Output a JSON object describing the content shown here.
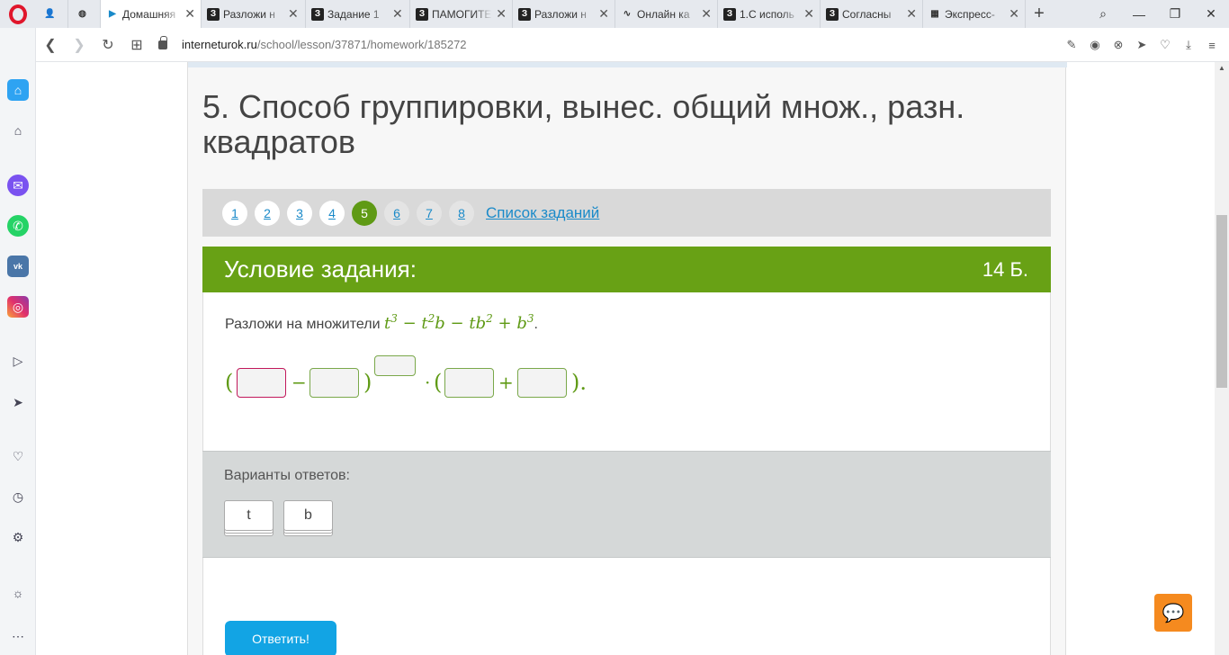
{
  "browser": {
    "tabs": [
      {
        "label": "",
        "icon": "avatar-icon"
      },
      {
        "label": "",
        "icon": "globe-icon"
      },
      {
        "label": "Домашняя",
        "icon": "play-icon"
      },
      {
        "label": "Разложи н",
        "icon": "znanija-icon"
      },
      {
        "label": "Задание 1",
        "icon": "znanija-icon"
      },
      {
        "label": "ПАМОГИТЕ",
        "icon": "znanija-icon"
      },
      {
        "label": "Разложи н",
        "icon": "znanija-icon"
      },
      {
        "label": "Онлайн ка",
        "icon": "calc-icon"
      },
      {
        "label": "1.С исполь",
        "icon": "znanija-icon"
      },
      {
        "label": "Согласны",
        "icon": "znanija-icon"
      },
      {
        "label": "Экспресс-",
        "icon": "grid-icon"
      }
    ],
    "url_host": "interneturok.ru",
    "url_path": "/school/lesson/37871/homework/185272"
  },
  "lesson": {
    "title": "5. Способ группировки, вынес. общий множ., разн. квадратов"
  },
  "pager": {
    "pages": [
      "1",
      "2",
      "3",
      "4",
      "5",
      "6",
      "7",
      "8"
    ],
    "current": "5",
    "list_link": "Список заданий"
  },
  "task": {
    "header_title": "Условие задания:",
    "points": "14 Б.",
    "statement_prefix": "Разложи на множители",
    "formula": {
      "t": "t",
      "b": "b",
      "exp3": "3",
      "exp2": "2",
      "minus": "−",
      "plus": "+"
    },
    "answer_ops": {
      "open": "(",
      "close": ")",
      "minus": "−",
      "plus": "+",
      "dot": "·",
      "end": ")."
    }
  },
  "options": {
    "label": "Варианты ответов:",
    "chips": [
      "t",
      "b"
    ]
  },
  "submit_label": "Ответить!",
  "colors": {
    "accent_green": "#68a115",
    "link_blue": "#1a8ac9",
    "submit_blue": "#12a4e4",
    "chat_orange": "#f58a1f"
  }
}
